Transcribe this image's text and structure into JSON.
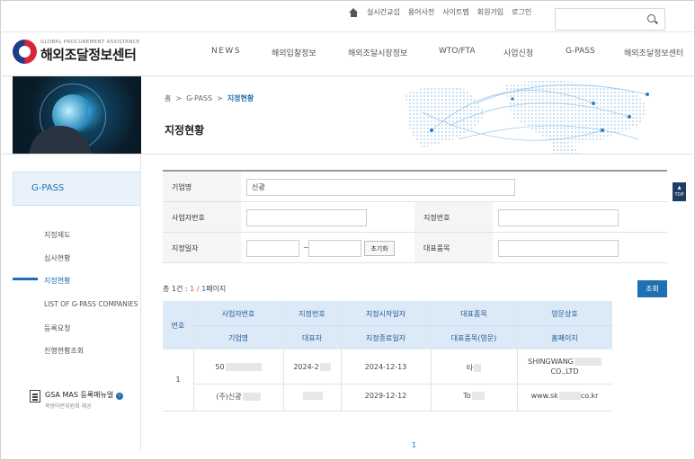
{
  "util": {
    "links": [
      "실시간교섭",
      "용어사전",
      "사이트맵",
      "회원가입",
      "로그인"
    ],
    "search_placeholder": ""
  },
  "logo": {
    "eng": "GLOBAL PROCUREMENT ASSISTANCE",
    "kor": "해외조달정보센터"
  },
  "gnb": [
    "NEWS",
    "해외입찰정보",
    "해외조달시장정보",
    "WTO/FTA",
    "사업신청",
    "G-PASS",
    "해외조달정보센터"
  ],
  "breadcrumb": {
    "home": "홈",
    "sep": ">",
    "level1": "G-PASS",
    "current": "지정현황"
  },
  "page_title": "지정현황",
  "lnb": {
    "title": "G-PASS",
    "items": [
      "지정제도",
      "심사현황",
      "지정현황",
      "LIST OF G-PASS COMPANIES",
      "등록요청",
      "진행현황조회"
    ],
    "active_index": 2,
    "manual_title": "GSA MAS 등록매뉴얼",
    "manual_sub": "북방마련위원회 제공"
  },
  "form": {
    "company_label": "기업명",
    "company_value": "신광",
    "bizno_label": "사업자번호",
    "bizno_value": "",
    "desig_no_label": "지정번호",
    "desig_no_value": "",
    "desig_date_label": "지정일자",
    "date_from": "",
    "date_tilde": "~",
    "date_to": "",
    "reset_label": "초기화",
    "product_label": "대표품목",
    "product_value": ""
  },
  "result": {
    "total_prefix": "총",
    "total": "1",
    "total_suffix": "건 :",
    "page_cur": "1",
    "page_sep": "/",
    "page_total": "1",
    "page_suffix": "페이지",
    "query_label": "조회"
  },
  "table": {
    "headers": {
      "no": "번호",
      "bizno": "사업자번호",
      "desig_no": "지정번호",
      "start": "지정시작일자",
      "product": "대표품목",
      "eng_name": "영문상호",
      "company": "기업명",
      "ceo": "대표자",
      "end": "지정종료일자",
      "product_eng": "대표품목(영문)",
      "homepage": "홈페이지"
    },
    "row": {
      "no": "1",
      "bizno": "50",
      "desig_no": "2024-2",
      "start": "2024-12-13",
      "product": "타",
      "eng_name_1": "SHINGWANG",
      "eng_name_2": "CO.,LTD",
      "company": "(주)신광",
      "ceo": "",
      "end": "2029-12-12",
      "product_eng": "To",
      "homepage_a": "www.sk",
      "homepage_b": "co.kr"
    }
  },
  "pager": {
    "current": "1"
  },
  "top_button": "TOP"
}
